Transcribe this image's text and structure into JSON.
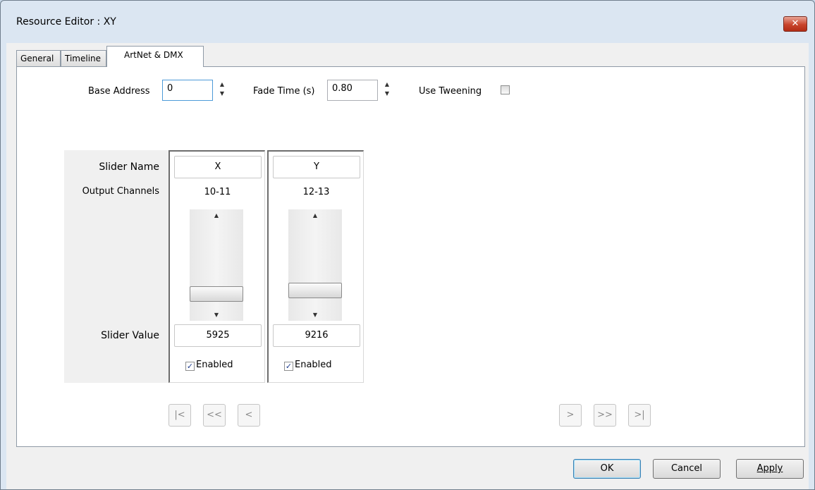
{
  "window": {
    "title": "Resource Editor  :  XY",
    "close_label": "✕"
  },
  "tabs": [
    {
      "label": "General"
    },
    {
      "label": "Timeline"
    },
    {
      "label": "ArtNet & DMX"
    }
  ],
  "settings": {
    "base_address_label": "Base Address",
    "base_address_value": "0",
    "fade_time_label": "Fade Time (s)",
    "fade_time_value": "0.80",
    "use_tweening_label": "Use Tweening",
    "use_tweening_checked": false
  },
  "row_labels": {
    "slider_name": "Slider Name",
    "output_channels": "Output Channels",
    "slider_value": "Slider Value"
  },
  "sliders": [
    {
      "name": "X",
      "channels": "10-11",
      "value": "5925",
      "enabled_label": "Enabled",
      "enabled": true,
      "level": 0.09
    },
    {
      "name": "Y",
      "channels": "12-13",
      "value": "9216",
      "enabled_label": "Enabled",
      "enabled": true,
      "level": 0.14
    }
  ],
  "nav": {
    "first": "|<",
    "prev_page": "<<",
    "prev": "<",
    "next": ">",
    "next_page": ">>",
    "last": ">|"
  },
  "buttons": {
    "ok": "OK",
    "cancel": "Cancel",
    "apply": "Apply"
  },
  "colors": {
    "title_bar": "#dbe6f2",
    "close_button": "#c8442c",
    "focus_border": "#4d9bd8"
  }
}
